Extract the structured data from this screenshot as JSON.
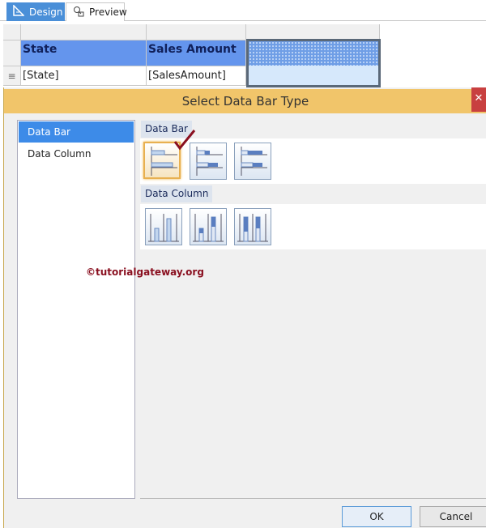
{
  "tabs": [
    {
      "label": "Design",
      "icon": "design-icon",
      "active": true
    },
    {
      "label": "Preview",
      "icon": "preview-icon",
      "active": false
    }
  ],
  "tablix": {
    "headers": [
      "State",
      "Sales Amount",
      ""
    ],
    "row": [
      "[State]",
      "[SalesAmount]",
      ""
    ]
  },
  "dialog": {
    "title": "Select Data Bar Type",
    "close": "✕",
    "categories": [
      {
        "label": "Data Bar",
        "selected": true
      },
      {
        "label": "Data Column",
        "selected": false
      }
    ],
    "sections": [
      {
        "label": "Data Bar"
      },
      {
        "label": "Data Column"
      }
    ],
    "watermark": "©tutorialgateway.org",
    "ok": "OK",
    "cancel": "Cancel"
  },
  "colors": {
    "accent": "#3d8be8",
    "title_bar": "#f1c56a",
    "header": "#6495ed"
  }
}
